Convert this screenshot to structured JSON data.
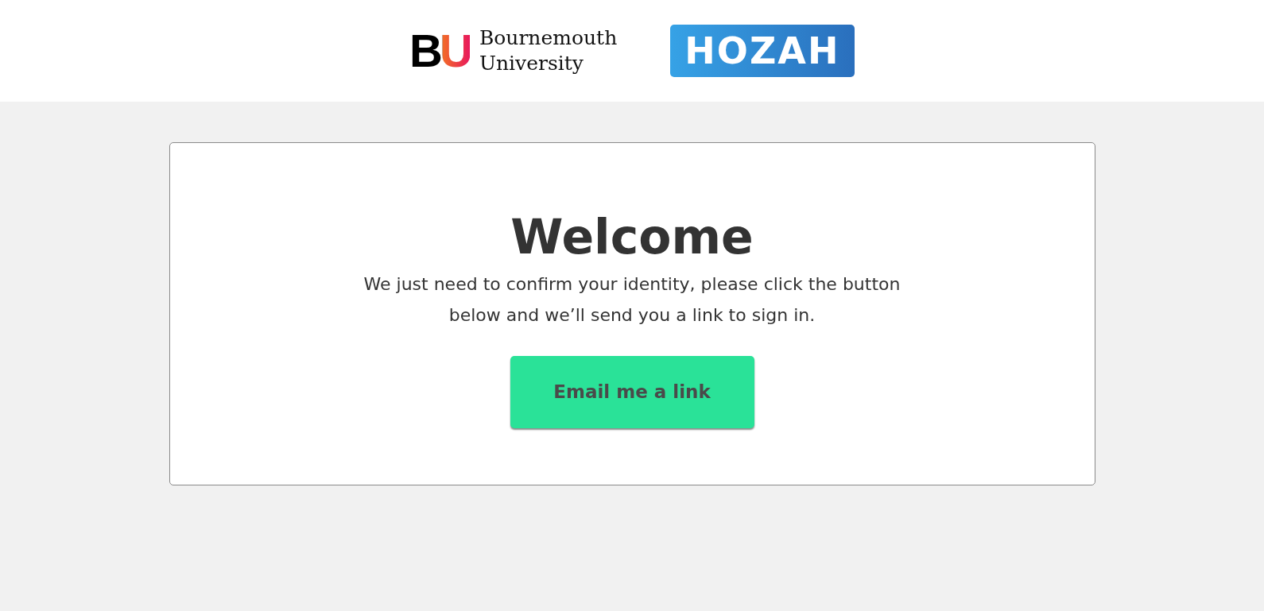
{
  "header": {
    "university_mark": "BU",
    "university_name": "Bournemouth University",
    "partner_logo": "HOZAH"
  },
  "card": {
    "title": "Welcome",
    "message": "We just need to confirm your identity, please click the button below and we’ll send you a link to sign in.",
    "button": "Email me a link"
  }
}
